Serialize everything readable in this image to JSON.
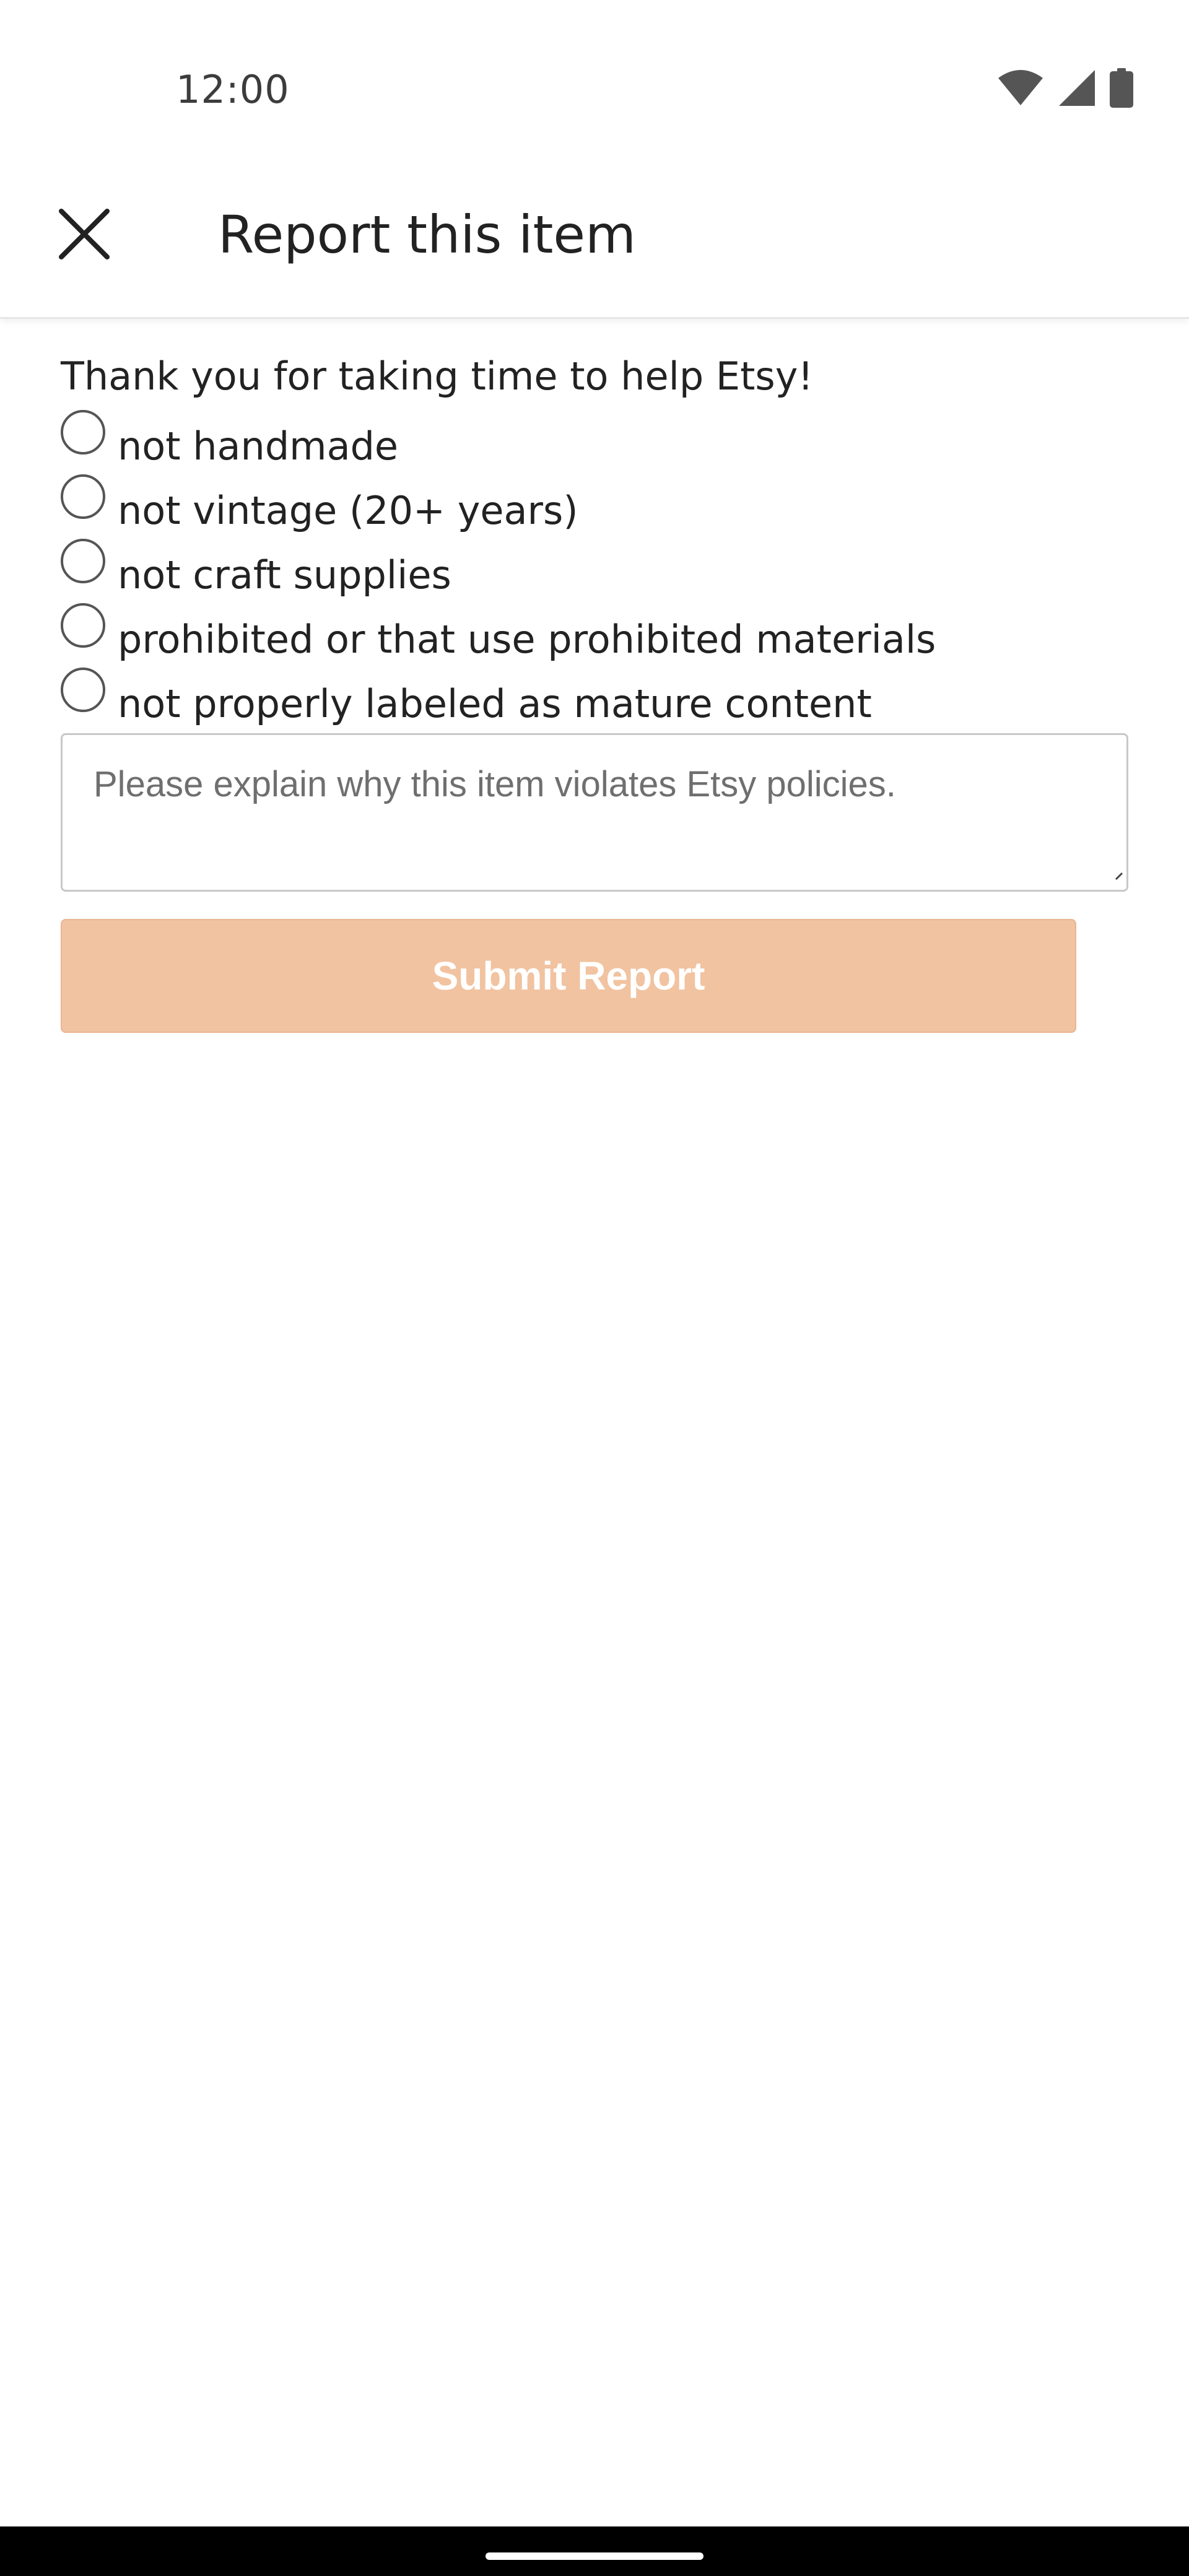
{
  "status_bar": {
    "time": "12:00",
    "icons": [
      "wifi-icon",
      "cellular-signal-icon",
      "battery-icon"
    ]
  },
  "app_bar": {
    "title": "Report this item",
    "close_icon": "close-icon"
  },
  "form": {
    "intro": "Thank you for taking time to help Etsy!",
    "options": [
      {
        "label": "not handmade",
        "selected": false
      },
      {
        "label": "not vintage (20+ years)",
        "selected": false
      },
      {
        "label": "not craft supplies",
        "selected": false
      },
      {
        "label": "prohibited or that use prohibited materials",
        "selected": false
      },
      {
        "label": "not properly labeled as mature content",
        "selected": false
      }
    ],
    "explanation": {
      "value": "",
      "placeholder": "Please explain why this item violates Etsy policies."
    },
    "submit_label": "Submit Report"
  },
  "colors": {
    "submit_button_bg": "#f1c3a0",
    "text": "#222222",
    "nav_bar": "#000000"
  }
}
